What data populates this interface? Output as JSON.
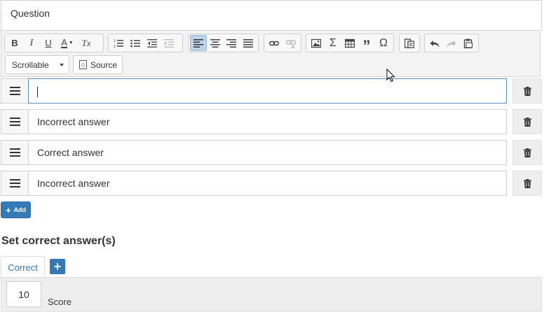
{
  "question": {
    "placeholder": "Question"
  },
  "toolbar": {
    "bold": "B",
    "italic": "I",
    "underline": "U",
    "font_color": "A",
    "clear_format": "Tx",
    "blockquote_icon": "quote-icon",
    "special_char": "Ω",
    "sigma": "Σ",
    "style_combo": "Scrollable",
    "source_label": "Source"
  },
  "answers": [
    {
      "value": "",
      "state": "focused"
    },
    {
      "value": "Incorrect answer"
    },
    {
      "value": "Correct answer"
    },
    {
      "value": "Incorrect answer"
    }
  ],
  "add_button": {
    "label": "Add"
  },
  "correct_section": {
    "title": "Set correct answer(s)",
    "tab_label": "Correct",
    "score_value": "10",
    "score_label": "Score"
  },
  "colors": {
    "primary": "#337ab7",
    "toolbar_bg": "#f3f3f3",
    "active_btn": "#bcd3ea"
  }
}
